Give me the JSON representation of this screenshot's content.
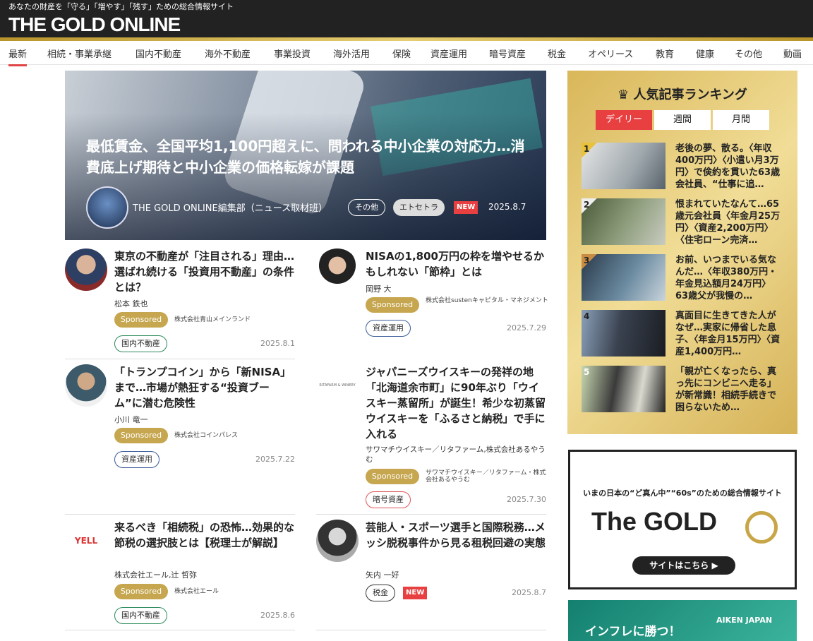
{
  "header": {
    "tagline": "あなたの財産を「守る」「増やす」「残す」ための総合情報サイト",
    "logo": "THE GOLD ONLINE"
  },
  "nav": [
    "最新",
    "相続・事業承継",
    "国内不動産",
    "海外不動産",
    "事業投資",
    "海外活用",
    "保険",
    "資産運用",
    "暗号資産",
    "税金",
    "オペリース",
    "教育",
    "健康",
    "その他",
    "動画"
  ],
  "hero": {
    "title": "最低賃金、全国平均1,100円超えに、問われる中小企業の対応力…消費底上げ期待と中小企業の価格転嫁が課題",
    "author": "THE GOLD ONLINE編集部（ニュース取材班）",
    "tags": [
      "その他",
      "エトセトラ"
    ],
    "new_label": "NEW",
    "date": "2025.8.7"
  },
  "articles": [
    {
      "title": "東京の不動産が「注目される」理由…選ばれ続ける「投資用不動産」の条件とは？",
      "author": "松本 鉄也",
      "sponsored": "Sponsored",
      "sponsor": "株式会社青山メインランド",
      "category": "国内不動産",
      "date": "2025.8.1"
    },
    {
      "title": "NISAの1,800万円の枠を増やせるかもしれない「節枠」とは",
      "author": "岡野 大",
      "sponsored": "Sponsored",
      "sponsor": "株式会社sustenキャピタル・マネジメント",
      "category": "資産運用",
      "date": "2025.7.29"
    },
    {
      "title": "「トランプコイン」から「新NISA」まで…市場が熱狂する“投資ブーム”に潜む危険性",
      "author": "小川 竜一",
      "sponsored": "Sponsored",
      "sponsor": "株式会社コインパレス",
      "category": "資産運用",
      "date": "2025.7.22"
    },
    {
      "title": "ジャパニーズウイスキーの発祥の地「北海道余市町」に90年ぶり「ウイスキー蒸留所」が誕生！希少な初蒸留ウイスキーを「ふるさと納税」で手に入れる",
      "author": "サワマチウイスキー／リタファーム,株式会社あるやうむ",
      "sponsored": "Sponsored",
      "sponsor": "サワマチウイスキー／リタファーム・株式会社あるやうむ",
      "category": "暗号資産",
      "date": "2025.7.30",
      "logo_text": "RITAFARM & WINERY"
    },
    {
      "title": "来るべき「相続税」の恐怖…効果的な節税の選択肢とは【税理士が解説】",
      "author": "株式会社エール,辻 哲弥",
      "sponsored": "Sponsored",
      "sponsor": "株式会社エール",
      "category": "国内不動産",
      "date": "2025.8.6",
      "logo_text": "YELL"
    },
    {
      "title": "芸能人・スポーツ選手と国際税務…メッシ脱税事件から見る租税回避の実態",
      "author": "矢内 一好",
      "category": "税金",
      "new_label": "NEW",
      "date": "2025.8.7"
    }
  ],
  "ranking": {
    "heading": "人気記事ランキング",
    "tabs": [
      "デイリー",
      "週間",
      "月間"
    ],
    "items": [
      {
        "num": "1",
        "title": "老後の夢、散る。〈年収400万円〉〈小遣い月3万円〉で倹約を貫いた63歳会社員、“仕事に追…"
      },
      {
        "num": "2",
        "title": "恨まれていたなんて…65歳元会社員〈年金月25万円〉〈資産2,200万円〉〈住宅ローン完済…"
      },
      {
        "num": "3",
        "title": "お前、いつまでいる気なんだ…〈年収380万円・年金見込額月24万円〉63歳父が我慢の…"
      },
      {
        "num": "4",
        "title": "真面目に生きてきた人がなぜ…実家に帰省した息子、〈年金月15万円〉〈資産1,400万円…"
      },
      {
        "num": "5",
        "title": "「親が亡くなったら、真っ先にコンビニへ走る」が新常識！相続手続きで困らないため…"
      }
    ]
  },
  "ads": {
    "gold60_sub": "いまの日本の“ど真ん中”“60s”のための総合情報サイト",
    "gold60_logo": "The GOLD",
    "gold60_button": "サイトはこちら ▶",
    "aiken_text": "インフレに勝つ！",
    "aiken_brand": "AIKEN JAPAN"
  }
}
